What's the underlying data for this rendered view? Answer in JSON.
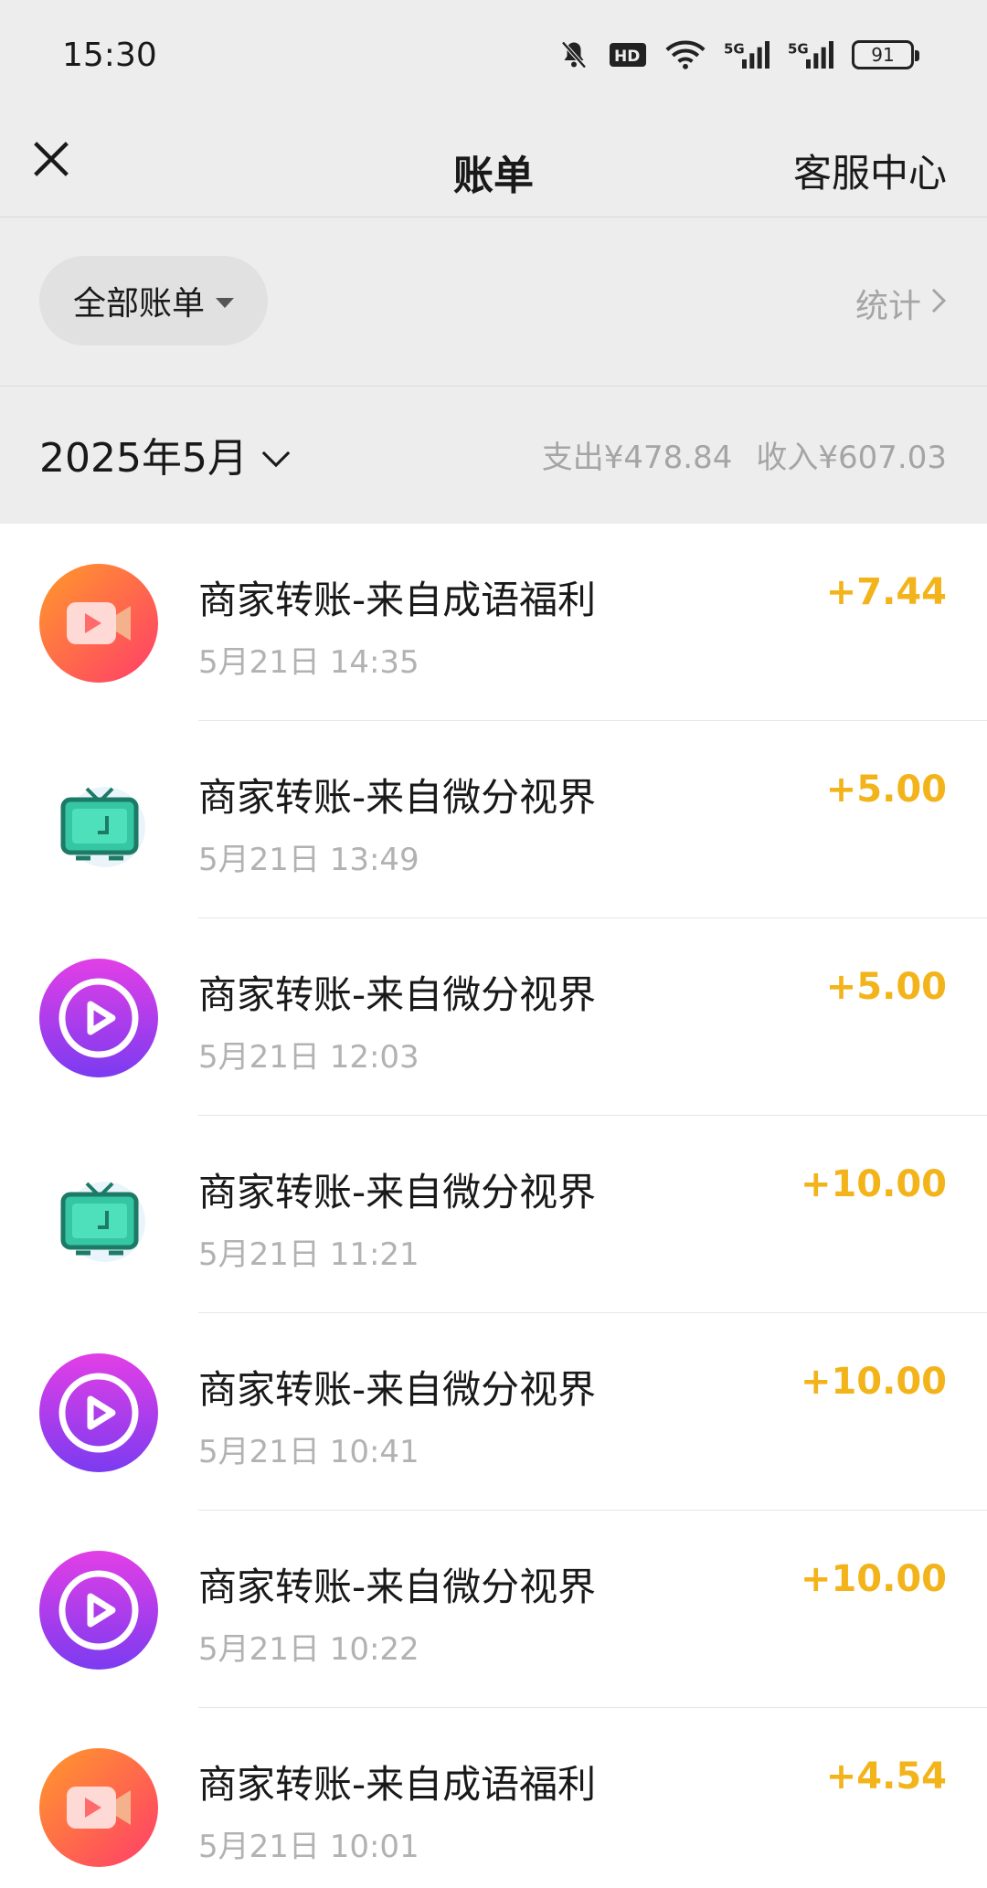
{
  "status_bar": {
    "time": "15:30",
    "battery": "91",
    "icons": [
      "mute-bell-icon",
      "hd-icon",
      "wifi-icon",
      "5g-signal-icon",
      "5g-signal-icon",
      "battery-icon"
    ]
  },
  "nav": {
    "title": "账单",
    "service_label": "客服中心"
  },
  "filter": {
    "label": "全部账单",
    "stats_label": "统计"
  },
  "month": {
    "label": "2025年5月",
    "expense": "支出¥478.84",
    "income": "收入¥607.03"
  },
  "colors": {
    "income_amount": "#f3b41b",
    "background": "#ededed",
    "list_background": "#ffffff"
  },
  "transactions": [
    {
      "icon": "idiom-welfare-app-icon",
      "title": "商家转账-来自成语福利",
      "time": "5月21日 14:35",
      "amount": "+7.44"
    },
    {
      "icon": "tv-app-icon",
      "title": "商家转账-来自微分视界",
      "time": "5月21日 13:49",
      "amount": "+5.00"
    },
    {
      "icon": "play-circle-app-icon",
      "title": "商家转账-来自微分视界",
      "time": "5月21日 12:03",
      "amount": "+5.00"
    },
    {
      "icon": "tv-app-icon",
      "title": "商家转账-来自微分视界",
      "time": "5月21日 11:21",
      "amount": "+10.00"
    },
    {
      "icon": "play-circle-app-icon",
      "title": "商家转账-来自微分视界",
      "time": "5月21日 10:41",
      "amount": "+10.00"
    },
    {
      "icon": "play-circle-app-icon",
      "title": "商家转账-来自微分视界",
      "time": "5月21日 10:22",
      "amount": "+10.00"
    },
    {
      "icon": "idiom-welfare-app-icon",
      "title": "商家转账-来自成语福利",
      "time": "5月21日 10:01",
      "amount": "+4.54"
    }
  ]
}
